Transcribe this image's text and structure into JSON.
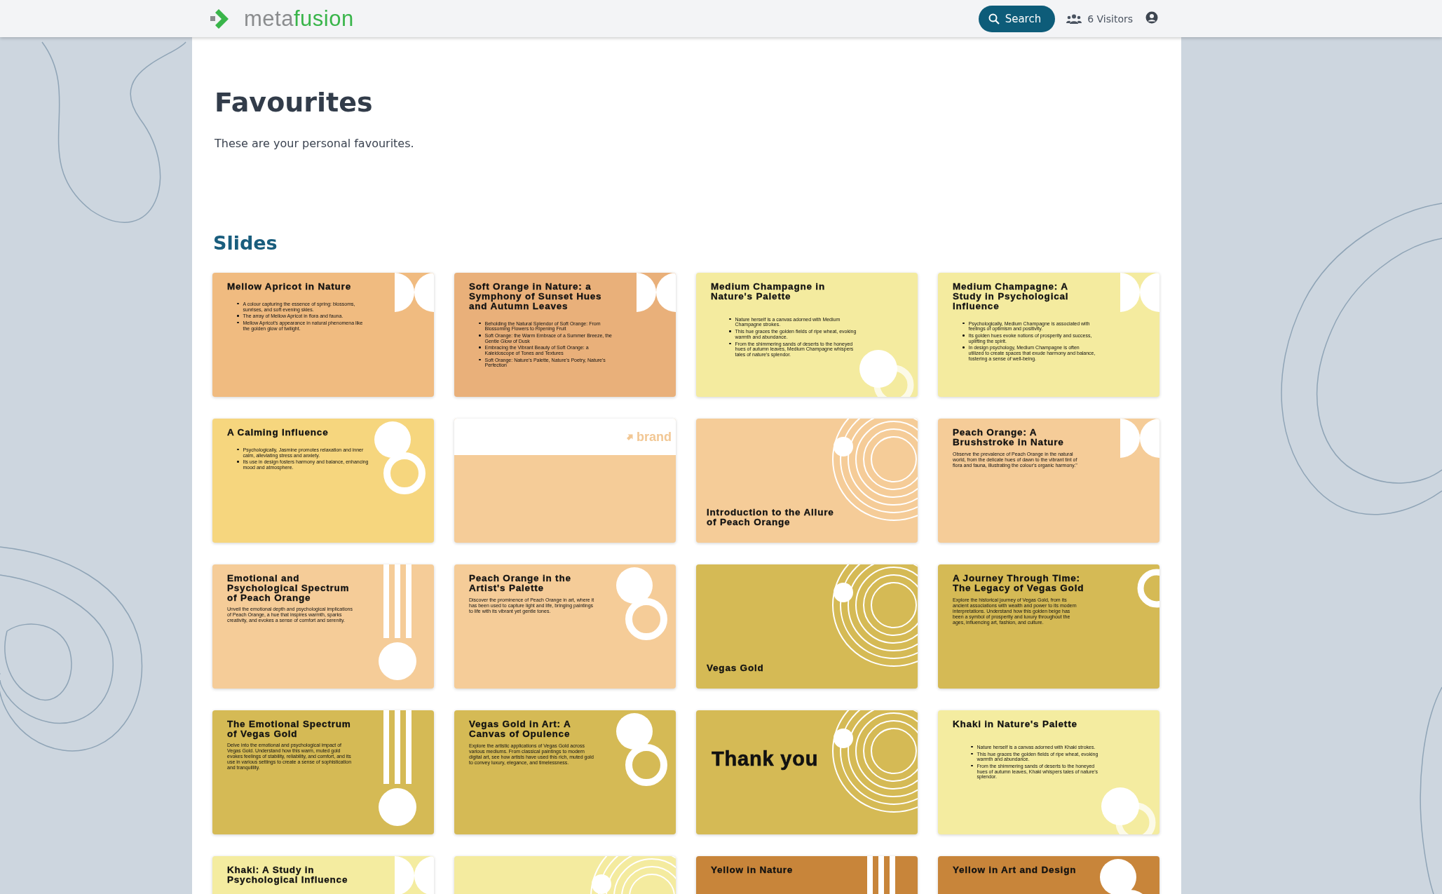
{
  "header": {
    "logo": {
      "prefix": "meta",
      "suffix": "fusion"
    },
    "search_button": "Search",
    "visitors": "6 Visitors"
  },
  "page": {
    "title": "Favourites",
    "subtitle": "These are your personal favourites."
  },
  "section": {
    "title": "Slides",
    "slides": [
      {
        "kind": "halves",
        "color": "#f0bb80",
        "title": "Mellow Apricot in Nature",
        "bullets": [
          "A colour capturing the essence of spring: blossoms, sunrises, and soft evening skies.",
          "The array of Mellow Apricot in flora and fauna.",
          "Mellow Apricot's appearance in natural phenomena like the golden glow of twilight."
        ]
      },
      {
        "kind": "halves",
        "color": "#e9b07a",
        "title": "Soft Orange in Nature: a Symphony of Sunset Hues and Autumn Leaves",
        "bullets": [
          "Beholding the Natural Splendor of Soft Orange: From Blossoming Flowers to Ripening Fruit",
          "Soft Orange: the Warm Embrace of a Summer Breeze, the Gentle Glow of Dusk",
          "Embracing the Vibrant Beauty of Soft Orange: a Kaleidoscope of Tones and Textures",
          "Soft Orange: Nature's Palette, Nature's Poetry, Nature's Perfection"
        ]
      },
      {
        "kind": "circle-ring-low",
        "color": "#f4eb9f",
        "title": "Medium Champagne in Nature's Palette",
        "bullets": [
          "Nature herself is a canvas adorned with Medium Champagne strokes.",
          "This hue graces the golden fields of ripe wheat, evoking warmth and abundance.",
          "From the shimmering sands of deserts to the honeyed hues of autumn leaves, Medium Champagne whispers tales of nature's splendor."
        ]
      },
      {
        "kind": "halves",
        "color": "#f4eb9f",
        "title": "Medium Champagne: A Study in Psychological Influence",
        "bullets": [
          "Psychologically, Medium Champagne is associated with feelings of optimism and positivity.",
          "Its golden hues evoke notions of prosperity and success, uplifting the spirit.",
          "In design psychology, Medium Champagne is often utilized to create spaces that exude harmony and balance, fostering a sense of well-being."
        ]
      },
      {
        "kind": "circle-ring",
        "color": "#f6d67e",
        "title": "A Calming Influence",
        "bullets": [
          "Psychologically, Jasmine promotes relaxation and inner calm, alleviating stress and anxiety.",
          "Its use in design fosters harmony and balance, enhancing mood and atmosphere."
        ]
      },
      {
        "kind": "brand",
        "color": "#f5cc98",
        "logo_text": "brand"
      },
      {
        "kind": "rings",
        "color": "#f5cc98",
        "title": "Introduction to the Allure of Peach Orange"
      },
      {
        "kind": "halves",
        "color": "#f5cc98",
        "title": "Peach Orange: A Brushstroke in Nature",
        "body": "Observe the prevalence of Peach Orange in the natural world, from the delicate hues of dawn to the vibrant tint of flora and fauna, illustrating the colour's organic harmony.\""
      },
      {
        "kind": "stripes",
        "color": "#f5cc98",
        "title": "Emotional and Psychological Spectrum of Peach Orange",
        "body": "Unveil the emotional depth and psychological implications of Peach Orange, a hue that inspires warmth, sparks creativity, and evokes a sense of comfort and serenity."
      },
      {
        "kind": "circle-ring",
        "color": "#f5cc98",
        "title": "Peach Orange in the Artist's Palette",
        "body": "Discover the prominence of Peach Orange in art, where it has been used to capture light and life, bringing paintings to life with its vibrant yet gentle tones."
      },
      {
        "kind": "rings",
        "color": "#d5ba55",
        "title": "Vegas Gold"
      },
      {
        "kind": "ring-edge",
        "color": "#d5ba55",
        "title": "A Journey Through Time: The Legacy of Vegas Gold",
        "body": "Explore the historical journey of Vegas Gold, from its ancient associations with wealth and power to its modern interpretations. Understand how this golden beige has been a symbol of prosperity and luxury throughout the ages, influencing art, fashion, and culture."
      },
      {
        "kind": "stripes",
        "color": "#d5ba55",
        "title": "The Emotional Spectrum of Vegas Gold",
        "body": "Delve into the emotional and psychological impact of Vegas Gold. Understand how this warm, muted gold evokes feelings of stability, reliability, and comfort, and its use in various settings to create a sense of sophistication and tranquillity."
      },
      {
        "kind": "circle-ring",
        "color": "#d5ba55",
        "title": "Vegas Gold in Art: A Canvas of Opulence",
        "body": "Explore the artistic applications of Vegas Gold across various mediums. From classical paintings to modern digital art, see how artists have used this rich, muted gold to convey luxury, elegance, and timelessness."
      },
      {
        "kind": "closing",
        "color": "#d5ba55",
        "title": "Thank you"
      },
      {
        "kind": "circle-ring-low",
        "color": "#f4eca0",
        "title": "Khaki in Nature's Palette",
        "bullets": [
          "Nature herself is a canvas adorned with Khaki strokes.",
          "This hue graces the golden fields of ripe wheat, evoking warmth and abundance.",
          "From the shimmering sands of deserts to the honeyed hues of autumn leaves, Khaki whispers tales of nature's splendor."
        ]
      },
      {
        "kind": "halves",
        "color": "#f4eca0",
        "title": "Khaki: A Study in Psychological Influence"
      },
      {
        "kind": "rings",
        "color": "#f4eb9f"
      },
      {
        "kind": "stripes",
        "color": "#c8853a",
        "title": "Yellow in Nature"
      },
      {
        "kind": "circle-ring",
        "color": "#c8853a",
        "title": "Yellow in Art and Design"
      }
    ]
  }
}
